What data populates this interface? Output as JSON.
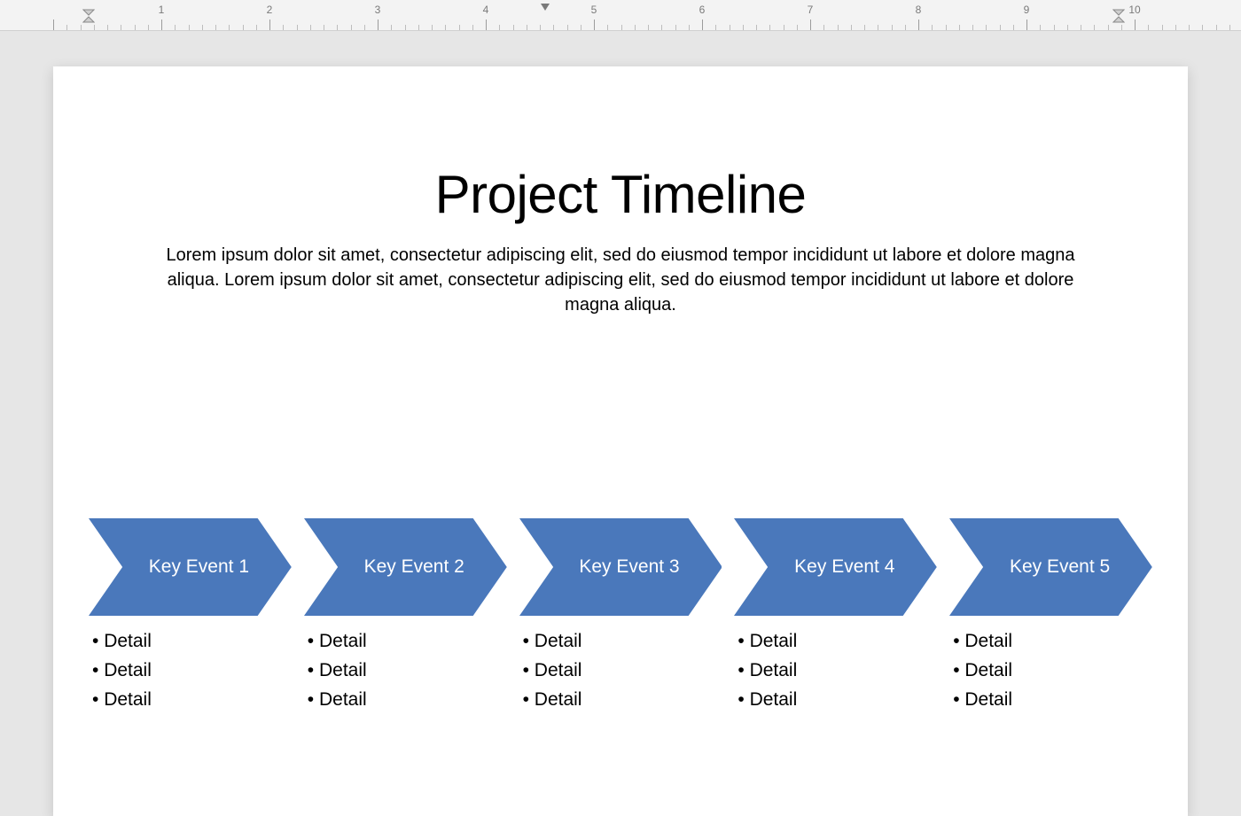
{
  "colors": {
    "shape_fill": "#4a78bb"
  },
  "ruler": {
    "numbers": [
      "1",
      "2",
      "3",
      "4",
      "5",
      "6",
      "7",
      "8",
      "9",
      "10"
    ]
  },
  "slide": {
    "title": "Project Timeline",
    "description": "Lorem ipsum dolor sit amet, consectetur adipiscing elit, sed do eiusmod tempor incididunt ut labore et dolore magna aliqua. Lorem ipsum dolor sit amet, consectetur adipiscing elit, sed do eiusmod tempor incididunt ut labore et dolore magna aliqua."
  },
  "timeline": {
    "events": [
      {
        "label": "Key Event 1",
        "details": [
          "Detail",
          "Detail",
          "Detail"
        ]
      },
      {
        "label": "Key Event 2",
        "details": [
          "Detail",
          "Detail",
          "Detail"
        ]
      },
      {
        "label": "Key Event 3",
        "details": [
          "Detail",
          "Detail",
          "Detail"
        ]
      },
      {
        "label": "Key Event 4",
        "details": [
          "Detail",
          "Detail",
          "Detail"
        ]
      },
      {
        "label": "Key Event 5",
        "details": [
          "Detail",
          "Detail",
          "Detail"
        ]
      }
    ]
  }
}
